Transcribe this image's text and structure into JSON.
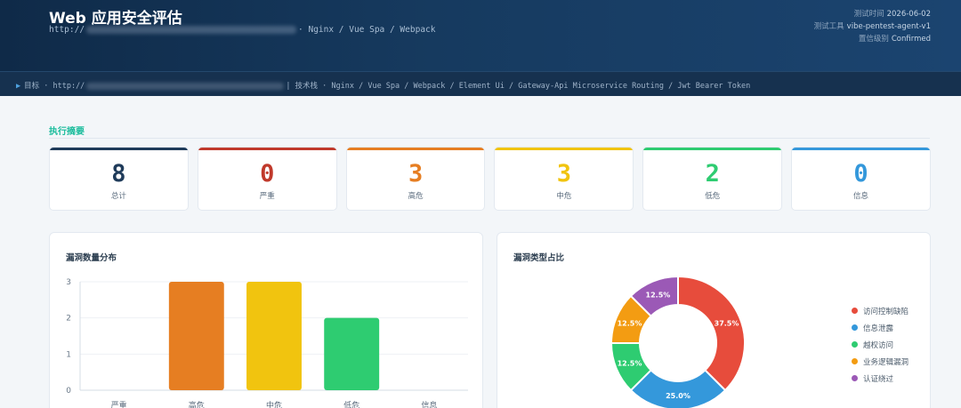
{
  "header": {
    "title": "Web 应用安全评估",
    "url_prefix": "http://",
    "url_suffix": "· Nginx / Vue Spa / Webpack",
    "meta": [
      {
        "key": "测试时间",
        "value": "2026-06-02"
      },
      {
        "key": "测试工具",
        "value": "vibe-pentest-agent-v1"
      },
      {
        "key": "置信级别",
        "value": "Confirmed"
      }
    ]
  },
  "target_bar": {
    "arrow_icon": "play-triangle-icon",
    "label": "目标 · http://",
    "stack": "|  技术栈 · Nginx / Vue Spa / Webpack / Element Ui / Gateway-Api Microservice Routing / Jwt Bearer Token"
  },
  "summary": {
    "title": "执行摘要",
    "cards": [
      {
        "value": "8",
        "label": "总计",
        "color": "#1f3b5a"
      },
      {
        "value": "0",
        "label": "严重",
        "color": "#c0392b"
      },
      {
        "value": "3",
        "label": "高危",
        "color": "#e67e22"
      },
      {
        "value": "3",
        "label": "中危",
        "color": "#f1c40f"
      },
      {
        "value": "2",
        "label": "低危",
        "color": "#2ecc71"
      },
      {
        "value": "0",
        "label": "信息",
        "color": "#3498db"
      }
    ]
  },
  "panels": {
    "bar_title": "漏洞数量分布",
    "pie_title": "漏洞类型占比"
  },
  "chart_data": [
    {
      "type": "bar",
      "categories": [
        "严重",
        "高危",
        "中危",
        "低危",
        "信息"
      ],
      "values": [
        0,
        3,
        3,
        2,
        0
      ],
      "colors": [
        "#c0392b",
        "#e67e22",
        "#f1c40f",
        "#2ecc71",
        "#3498db"
      ],
      "yticks": [
        "0",
        "1",
        "2",
        "3"
      ],
      "ylim": [
        0,
        3
      ],
      "grid": true
    },
    {
      "type": "pie",
      "donut": true,
      "labels": [
        "访问控制缺陷",
        "信息泄露",
        "越权访问",
        "业务逻辑漏洞",
        "认证绕过"
      ],
      "values": [
        37.5,
        25.0,
        12.5,
        12.5,
        12.5
      ],
      "value_labels": [
        "37.5%",
        "25.0%",
        "12.5%",
        "12.5%",
        "12.5%"
      ],
      "colors": [
        "#e74c3c",
        "#3498db",
        "#2ecc71",
        "#f39c12",
        "#9b59b6"
      ],
      "legend": "right"
    }
  ]
}
